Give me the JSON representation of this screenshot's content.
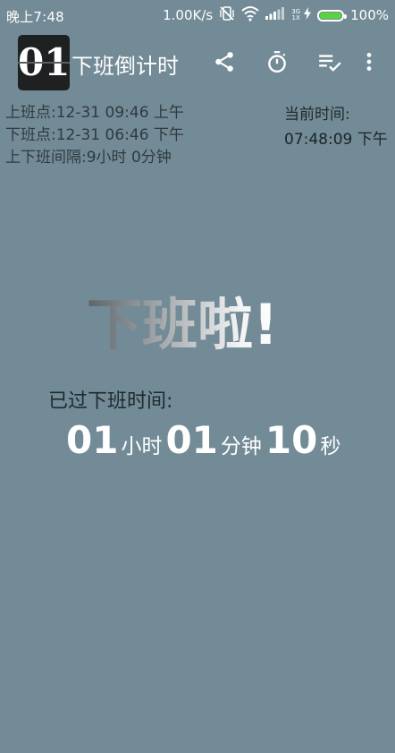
{
  "status_bar": {
    "time": "晚上7:48",
    "net_speed": "1.00K/s",
    "network_type_top": "3G",
    "network_type_bottom": "1X",
    "battery_percent": "100%",
    "battery_level": 1.0,
    "battery_color": "#5ad43c"
  },
  "toolbar": {
    "logo_text": "01",
    "title": "下班倒计时",
    "actions": [
      "share-icon",
      "timer-icon",
      "playlist-check-icon",
      "more-vert-icon"
    ]
  },
  "info": {
    "start_line": "上班点:12-31 09:46 上午",
    "end_line": "下班点:12-31 06:46 下午",
    "interval_line": "上下班间隔:9小时 0分钟",
    "current_label": "当前时间:",
    "current_value": "07:48:09 下午"
  },
  "main": {
    "message": "下班啦!",
    "elapsed_label": "已过下班时间:",
    "countdown": {
      "hours": "01",
      "hours_unit": "小时",
      "minutes": "01",
      "minutes_unit": "分钟",
      "seconds": "10",
      "seconds_unit": "秒"
    }
  },
  "colors": {
    "background": "#728b96",
    "text_dark": "#2f3b40",
    "text_light": "#ffffff"
  }
}
